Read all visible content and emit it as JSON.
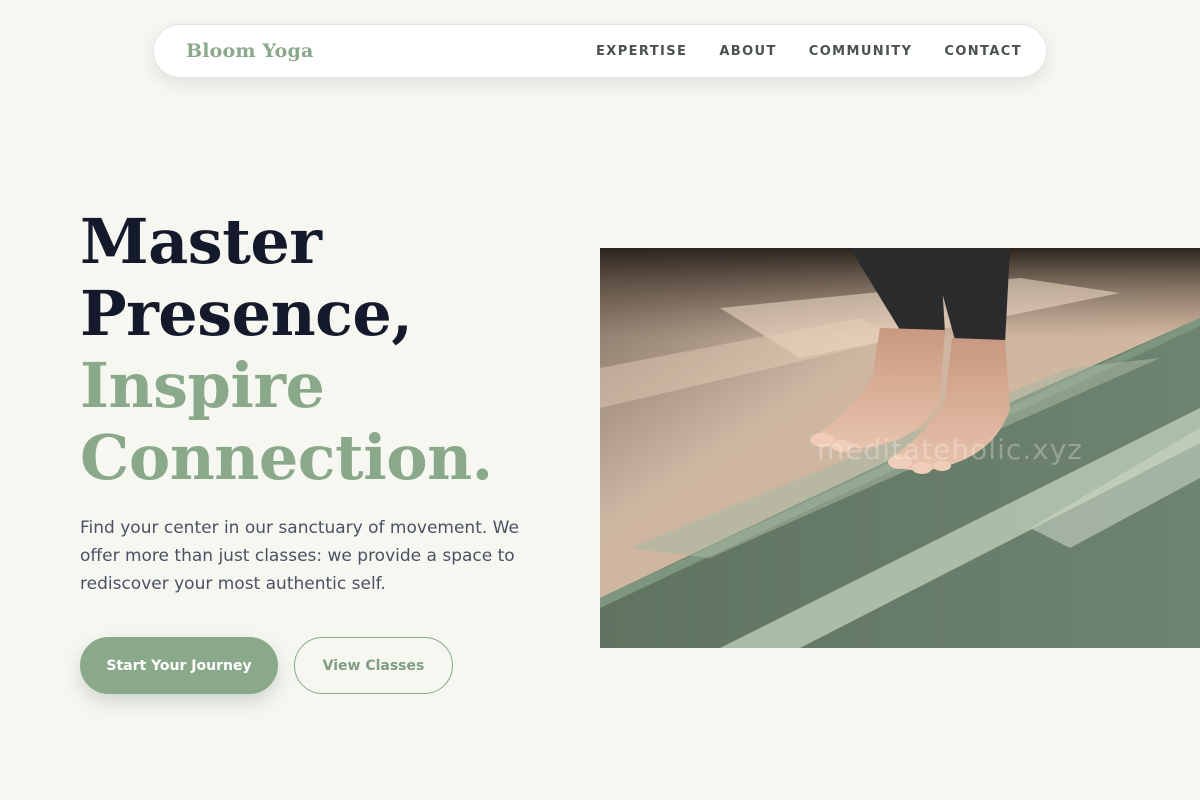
{
  "nav": {
    "brand": "Bloom Yoga",
    "links": [
      "EXPERTISE",
      "ABOUT",
      "COMMUNITY",
      "CONTACT"
    ]
  },
  "hero": {
    "headline_line1": "Master",
    "headline_line2": "Presence,",
    "headline_line3": "Inspire",
    "headline_line4": "Connection.",
    "lead": "Find your center in our sanctuary of movement. We offer more than just classes: we provide a space to rediscover your most authentic self.",
    "primary_button": "Start Your Journey",
    "secondary_button": "View Classes",
    "image_watermark": "meditateholic.xyz"
  },
  "colors": {
    "background": "#f7f7f2",
    "accent": "#8aa98a",
    "headline_dark": "#141a2c"
  }
}
